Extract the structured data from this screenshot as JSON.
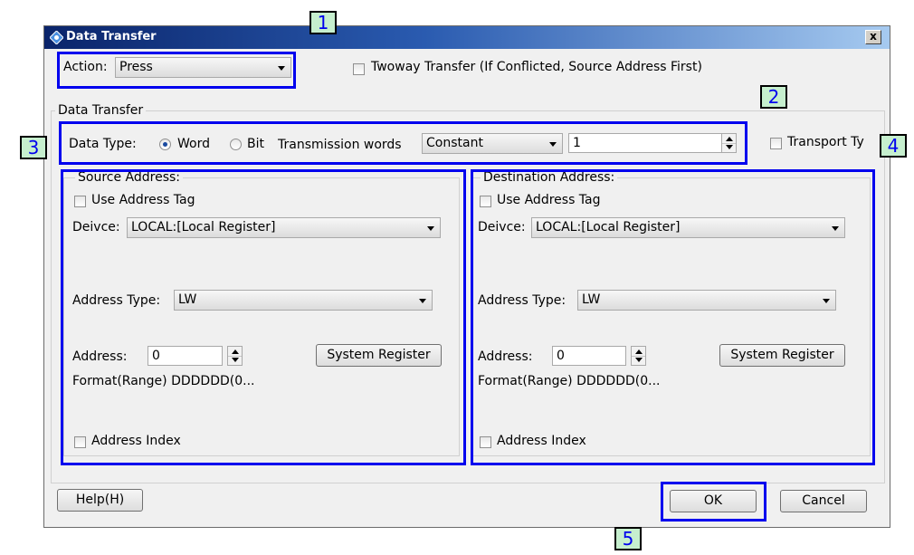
{
  "window": {
    "title": "Data Transfer",
    "close_label": "x"
  },
  "action": {
    "label": "Action:",
    "value": "Press",
    "twoway_label": "Twoway Transfer (If Conflicted, Source Address First)",
    "twoway_checked": false
  },
  "data_transfer": {
    "group_label": "Data Transfer",
    "data_type_label": "Data Type:",
    "word_label": "Word",
    "bit_label": "Bit",
    "selected_type": "Word",
    "transmission_label": "Transmission words",
    "transmission_mode": "Constant",
    "transmission_value": "1",
    "transport_label": "Transport Ty"
  },
  "source": {
    "group_label": "Source Address:",
    "use_tag_label": "Use Address Tag",
    "device_label": "Deivce:",
    "device_value": "LOCAL:[Local Register]",
    "address_type_label": "Address Type:",
    "address_type_value": "LW",
    "address_label": "Address:",
    "address_value": "0",
    "system_register_label": "System Register",
    "format_label": "Format(Range)  DDDDDD(0...",
    "address_index_label": "Address Index"
  },
  "destination": {
    "group_label": "Destination Address:",
    "use_tag_label": "Use Address Tag",
    "device_label": "Deivce:",
    "device_value": "LOCAL:[Local Register]",
    "address_type_label": "Address Type:",
    "address_type_value": "LW",
    "address_label": "Address:",
    "address_value": "0",
    "system_register_label": "System Register",
    "format_label": "Format(Range)  DDDDDD(0...",
    "address_index_label": "Address Index"
  },
  "footer": {
    "help_label": "Help(H)",
    "ok_label": "OK",
    "cancel_label": "Cancel"
  },
  "callouts": [
    "1",
    "2",
    "3",
    "4",
    "5"
  ],
  "colors": {
    "highlight": "#0000ee",
    "callout_bg": "#c6efce",
    "title_start": "#0a246a",
    "title_end": "#a6caf0"
  }
}
